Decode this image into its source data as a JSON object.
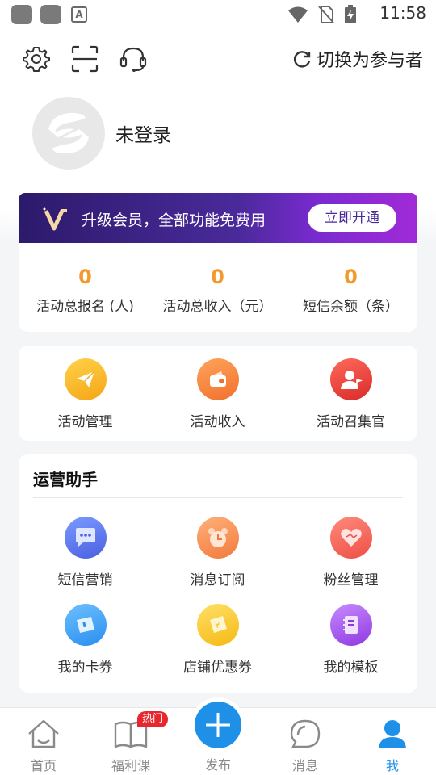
{
  "status_bar": {
    "time": "11:58"
  },
  "toolbar": {
    "switch_role_label": "切换为参与者"
  },
  "profile": {
    "login_status": "未登录"
  },
  "vip_banner": {
    "text": "升级会员，全部功能免费用",
    "button": "立即开通"
  },
  "stats": [
    {
      "value": "0",
      "label": "活动总报名 (人)"
    },
    {
      "value": "0",
      "label": "活动总收入（元）"
    },
    {
      "value": "0",
      "label": "短信余额（条）"
    }
  ],
  "functions": [
    {
      "label": "活动管理",
      "icon": "paper-plane-icon",
      "color": "#f7b21f"
    },
    {
      "label": "活动收入",
      "icon": "wallet-icon",
      "color": "#f5833a"
    },
    {
      "label": "活动召集官",
      "icon": "person-flag-icon",
      "color": "#e8413a"
    }
  ],
  "operations": {
    "title": "运营助手",
    "items": [
      {
        "label": "短信营销",
        "icon": "chat-bubble-icon",
        "color": "#5b7cf0"
      },
      {
        "label": "消息订阅",
        "icon": "alarm-clock-icon",
        "color": "#f5833a"
      },
      {
        "label": "粉丝管理",
        "icon": "heart-icon",
        "color": "#f05a4d"
      },
      {
        "label": "我的卡券",
        "icon": "ticket-icon",
        "color": "#3b9cf0"
      },
      {
        "label": "店铺优惠券",
        "icon": "coupon-icon",
        "color": "#f7c325"
      },
      {
        "label": "我的模板",
        "icon": "notebook-icon",
        "color": "#a54ae0"
      }
    ]
  },
  "bottom_nav": {
    "items": [
      {
        "label": "首页",
        "icon": "home-icon"
      },
      {
        "label": "福利课",
        "icon": "book-icon",
        "badge": "热门"
      },
      {
        "label": "发布",
        "icon": "plus-icon"
      },
      {
        "label": "消息",
        "icon": "message-bubble-icon"
      },
      {
        "label": "我",
        "icon": "person-icon",
        "active": true
      }
    ],
    "active_color": "#1e90e8"
  }
}
